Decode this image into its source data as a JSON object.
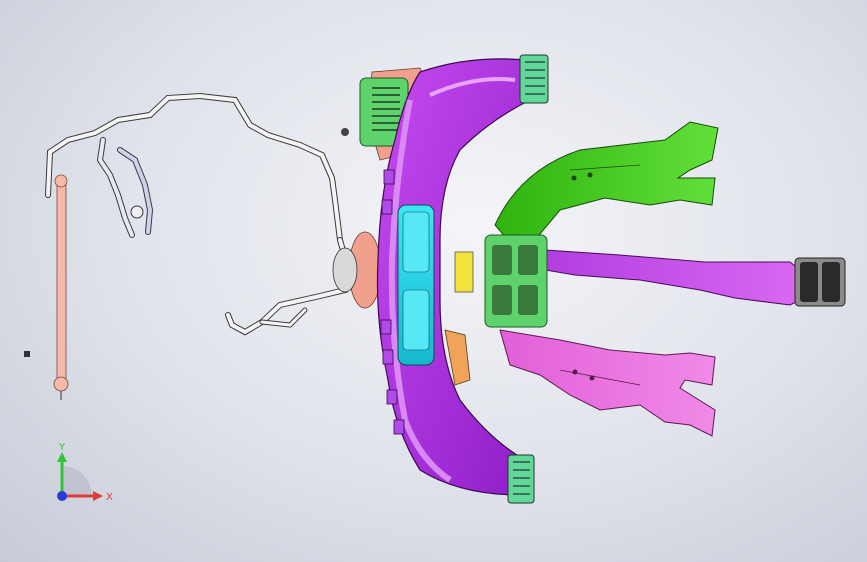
{
  "viewport": {
    "background_top": "#f4f5f8",
    "background_bottom": "#c6cbd6"
  },
  "model_parts": [
    {
      "name": "instrument-panel-cross-beam",
      "color": "#a82be0"
    },
    {
      "name": "center-console-bracket-upper",
      "color": "#3fd11b"
    },
    {
      "name": "center-console-bracket-lower",
      "color": "#e25fd8"
    },
    {
      "name": "center-duct",
      "color": "#c13ee0"
    },
    {
      "name": "cyan-vent-panel",
      "color": "#22d3e6"
    },
    {
      "name": "green-hvac-module",
      "color": "#5fd36b"
    },
    {
      "name": "salmon-bracket",
      "color": "#f0a08c"
    },
    {
      "name": "wire-harness",
      "color": "#f2f2f2"
    },
    {
      "name": "steering-support-rod",
      "color": "#f7b8a8"
    },
    {
      "name": "yellow-clip",
      "color": "#f3e23a"
    },
    {
      "name": "orange-brace",
      "color": "#f2a35a"
    }
  ],
  "triad": {
    "y_label": "Y",
    "x_label": "X",
    "y_color": "#34c43a",
    "x_color": "#e23a3a",
    "z_color": "#2a3ad6"
  }
}
